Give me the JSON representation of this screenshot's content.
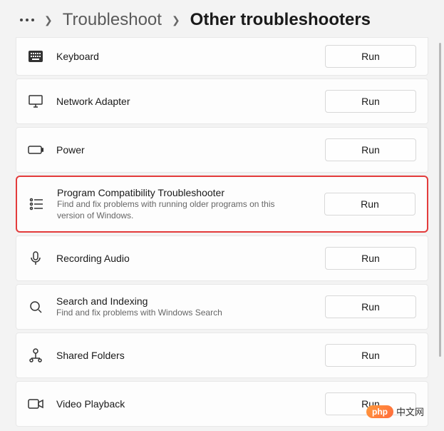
{
  "breadcrumb": {
    "parent": "Troubleshoot",
    "current": "Other troubleshooters"
  },
  "buttons": {
    "run": "Run"
  },
  "items": [
    {
      "id": "keyboard",
      "title": "Keyboard",
      "desc": "",
      "icon": "keyboard-icon"
    },
    {
      "id": "network-adapter",
      "title": "Network Adapter",
      "desc": "",
      "icon": "monitor-icon"
    },
    {
      "id": "power",
      "title": "Power",
      "desc": "",
      "icon": "battery-icon"
    },
    {
      "id": "program-compatibility",
      "title": "Program Compatibility Troubleshooter",
      "desc": "Find and fix problems with running older programs on this version of Windows.",
      "icon": "list-settings-icon",
      "highlighted": true
    },
    {
      "id": "recording-audio",
      "title": "Recording Audio",
      "desc": "",
      "icon": "microphone-icon"
    },
    {
      "id": "search-indexing",
      "title": "Search and Indexing",
      "desc": "Find and fix problems with Windows Search",
      "icon": "search-icon"
    },
    {
      "id": "shared-folders",
      "title": "Shared Folders",
      "desc": "",
      "icon": "shared-folder-icon"
    },
    {
      "id": "video-playback",
      "title": "Video Playback",
      "desc": "",
      "icon": "video-icon"
    }
  ],
  "watermark": {
    "badge": "php",
    "text": "中文网"
  }
}
